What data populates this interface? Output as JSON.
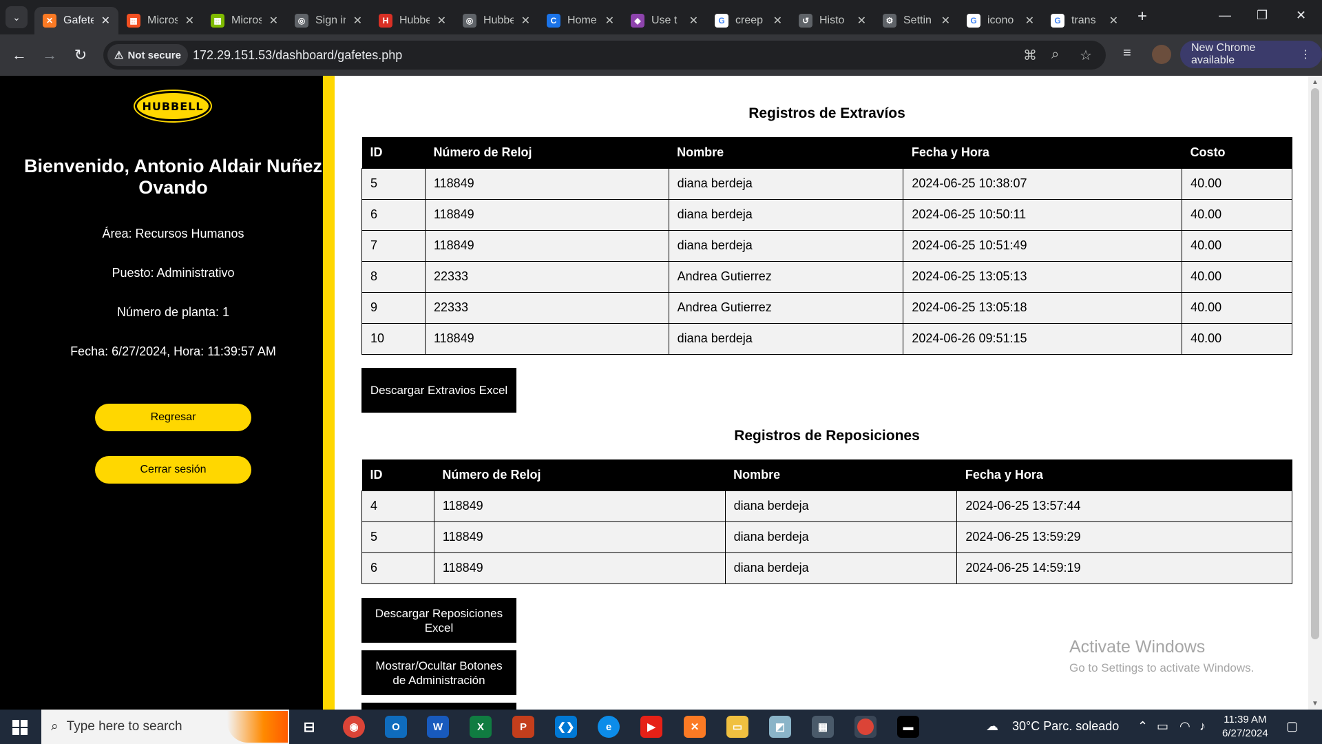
{
  "browser": {
    "tabs": [
      {
        "label": "Gafetes",
        "favicon": "xampp-icon",
        "color": "#fb7a24",
        "glyph": "✕",
        "active": true
      },
      {
        "label": "Microsoft",
        "favicon": "microsoft-icon",
        "color": "#f25022",
        "glyph": "▦",
        "active": false
      },
      {
        "label": "Microsoft",
        "favicon": "microsoft-icon",
        "color": "#7fba00",
        "glyph": "▦",
        "active": false
      },
      {
        "label": "Sign in",
        "favicon": "globe-icon",
        "color": "#5f6368",
        "glyph": "◎",
        "active": false
      },
      {
        "label": "Hubbell",
        "favicon": "hubbell-icon",
        "color": "#d93025",
        "glyph": "H",
        "active": false
      },
      {
        "label": "Hubbell",
        "favicon": "globe-icon",
        "color": "#5f6368",
        "glyph": "◎",
        "active": false
      },
      {
        "label": "Home",
        "favicon": "home-icon",
        "color": "#1a73e8",
        "glyph": "C",
        "active": false
      },
      {
        "label": "Use t",
        "favicon": "copilot-icon",
        "color": "#8e44ad",
        "glyph": "◆",
        "active": false
      },
      {
        "label": "creep",
        "favicon": "google-icon",
        "color": "#ffffff",
        "glyph": "G",
        "active": false
      },
      {
        "label": "Histo",
        "favicon": "history-icon",
        "color": "#5f6368",
        "glyph": "↺",
        "active": false
      },
      {
        "label": "Settin",
        "favicon": "gear-icon",
        "color": "#5f6368",
        "glyph": "⚙",
        "active": false
      },
      {
        "label": "icono",
        "favicon": "google-icon",
        "color": "#ffffff",
        "glyph": "G",
        "active": false
      },
      {
        "label": "trans",
        "favicon": "google-icon",
        "color": "#ffffff",
        "glyph": "G",
        "active": false
      }
    ],
    "security_label": "Not secure",
    "url": "172.29.151.53/dashboard/gafetes.php",
    "update_label": "New Chrome available"
  },
  "sidebar": {
    "logo_text": "HUBBELL",
    "welcome": "Bienvenido, Antonio Aldair Nuñez Ovando",
    "area": "Área: Recursos Humanos",
    "puesto": "Puesto: Administrativo",
    "planta": "Número de planta: 1",
    "fecha": "Fecha: 6/27/2024, Hora: 11:39:57 AM",
    "regresar_label": "Regresar",
    "logout_label": "Cerrar sesión"
  },
  "extravios": {
    "title": "Registros de Extravíos",
    "headers": [
      "ID",
      "Número de Reloj",
      "Nombre",
      "Fecha y Hora",
      "Costo"
    ],
    "rows": [
      [
        "5",
        "118849",
        "diana berdeja",
        "2024-06-25 10:38:07",
        "40.00"
      ],
      [
        "6",
        "118849",
        "diana berdeja",
        "2024-06-25 10:50:11",
        "40.00"
      ],
      [
        "7",
        "118849",
        "diana berdeja",
        "2024-06-25 10:51:49",
        "40.00"
      ],
      [
        "8",
        "22333",
        "Andrea Gutierrez",
        "2024-06-25 13:05:13",
        "40.00"
      ],
      [
        "9",
        "22333",
        "Andrea Gutierrez",
        "2024-06-25 13:05:18",
        "40.00"
      ],
      [
        "10",
        "118849",
        "diana berdeja",
        "2024-06-26 09:51:15",
        "40.00"
      ]
    ],
    "download_label": "Descargar Extravios Excel"
  },
  "reposiciones": {
    "title": "Registros de Reposiciones",
    "headers": [
      "ID",
      "Número de Reloj",
      "Nombre",
      "Fecha y Hora"
    ],
    "rows": [
      [
        "4",
        "118849",
        "diana berdeja",
        "2024-06-25 13:57:44"
      ],
      [
        "5",
        "118849",
        "diana berdeja",
        "2024-06-25 13:59:29"
      ],
      [
        "6",
        "118849",
        "diana berdeja",
        "2024-06-25 14:59:19"
      ]
    ],
    "download_label": "Descargar Reposiciones Excel",
    "toggle_admin_label": "Mostrar/Ocultar Botones de Administración"
  },
  "watermark": {
    "line1": "Activate Windows",
    "line2": "Go to Settings to activate Windows."
  },
  "taskbar": {
    "search_placeholder": "Type here to search",
    "weather": "30°C  Parc. soleado",
    "time": "11:39 AM",
    "date": "6/27/2024"
  },
  "colors": {
    "accent_yellow": "#ffd700",
    "sidebar_bg": "#000000",
    "cell_bg": "#f2f2f2"
  }
}
